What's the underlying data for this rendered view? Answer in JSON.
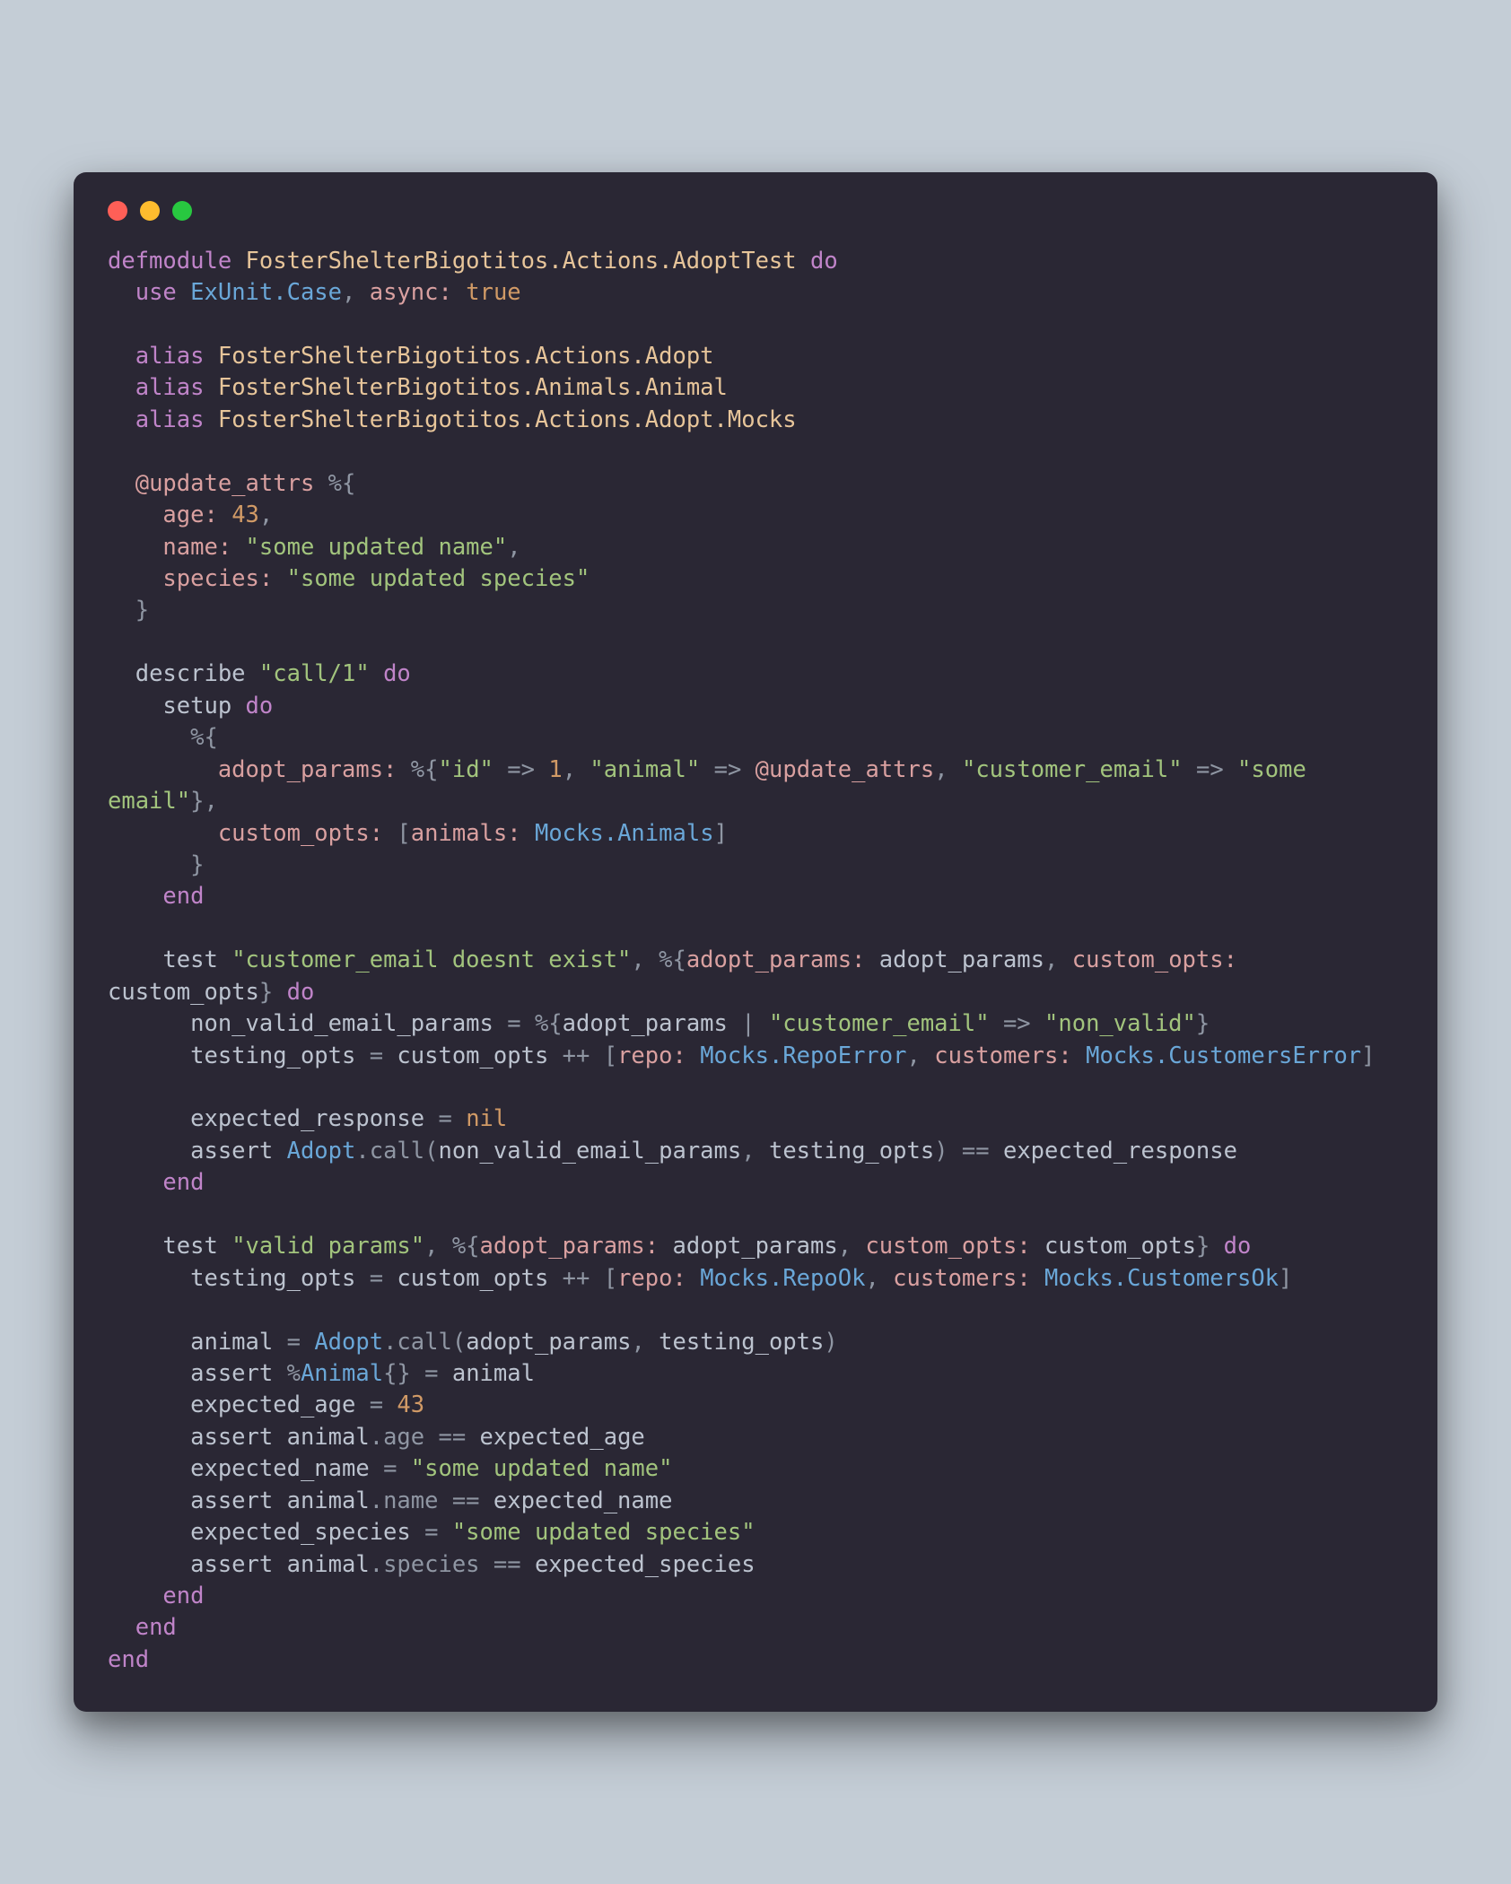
{
  "code": {
    "tokens": [
      [
        [
          "kw",
          "defmodule"
        ],
        [
          "punc",
          " "
        ],
        [
          "mod",
          "FosterShelterBigotitos.Actions.AdoptTest"
        ],
        [
          "punc",
          " "
        ],
        [
          "kw",
          "do"
        ]
      ],
      [
        [
          "punc",
          "  "
        ],
        [
          "kw",
          "use"
        ],
        [
          "punc",
          " "
        ],
        [
          "cls",
          "ExUnit.Case"
        ],
        [
          "punc",
          ", "
        ],
        [
          "atom",
          "async:"
        ],
        [
          "punc",
          " "
        ],
        [
          "bool",
          "true"
        ]
      ],
      [],
      [
        [
          "punc",
          "  "
        ],
        [
          "kw",
          "alias"
        ],
        [
          "punc",
          " "
        ],
        [
          "mod",
          "FosterShelterBigotitos.Actions.Adopt"
        ]
      ],
      [
        [
          "punc",
          "  "
        ],
        [
          "kw",
          "alias"
        ],
        [
          "punc",
          " "
        ],
        [
          "mod",
          "FosterShelterBigotitos.Animals.Animal"
        ]
      ],
      [
        [
          "punc",
          "  "
        ],
        [
          "kw",
          "alias"
        ],
        [
          "punc",
          " "
        ],
        [
          "mod",
          "FosterShelterBigotitos.Actions.Adopt.Mocks"
        ]
      ],
      [],
      [
        [
          "punc",
          "  "
        ],
        [
          "atom",
          "@update_attrs"
        ],
        [
          "punc",
          " %{"
        ]
      ],
      [
        [
          "punc",
          "    "
        ],
        [
          "atom",
          "age:"
        ],
        [
          "punc",
          " "
        ],
        [
          "num",
          "43"
        ],
        [
          "punc",
          ","
        ]
      ],
      [
        [
          "punc",
          "    "
        ],
        [
          "atom",
          "name:"
        ],
        [
          "punc",
          " "
        ],
        [
          "str",
          "\"some updated name\""
        ],
        [
          "punc",
          ","
        ]
      ],
      [
        [
          "punc",
          "    "
        ],
        [
          "atom",
          "species:"
        ],
        [
          "punc",
          " "
        ],
        [
          "str",
          "\"some updated species\""
        ]
      ],
      [
        [
          "punc",
          "  }"
        ]
      ],
      [],
      [
        [
          "punc",
          "  "
        ],
        [
          "id",
          "describe "
        ],
        [
          "str",
          "\"call/1\""
        ],
        [
          "punc",
          " "
        ],
        [
          "kw",
          "do"
        ]
      ],
      [
        [
          "punc",
          "    "
        ],
        [
          "id",
          "setup "
        ],
        [
          "kw",
          "do"
        ]
      ],
      [
        [
          "punc",
          "      %{"
        ]
      ],
      [
        [
          "punc",
          "        "
        ],
        [
          "atom",
          "adopt_params:"
        ],
        [
          "punc",
          " %{"
        ],
        [
          "str",
          "\"id\""
        ],
        [
          "punc",
          " => "
        ],
        [
          "num",
          "1"
        ],
        [
          "punc",
          ", "
        ],
        [
          "str",
          "\"animal\""
        ],
        [
          "punc",
          " => "
        ],
        [
          "atom",
          "@update_attrs"
        ],
        [
          "punc",
          ", "
        ],
        [
          "str",
          "\"customer_email\""
        ],
        [
          "punc",
          " => "
        ],
        [
          "str",
          "\"some email\""
        ],
        [
          "punc",
          "},"
        ]
      ],
      [
        [
          "punc",
          "        "
        ],
        [
          "atom",
          "custom_opts:"
        ],
        [
          "punc",
          " ["
        ],
        [
          "atom",
          "animals:"
        ],
        [
          "punc",
          " "
        ],
        [
          "cls",
          "Mocks.Animals"
        ],
        [
          "punc",
          "]"
        ]
      ],
      [
        [
          "punc",
          "      }"
        ]
      ],
      [
        [
          "punc",
          "    "
        ],
        [
          "kw",
          "end"
        ]
      ],
      [],
      [
        [
          "punc",
          "    "
        ],
        [
          "id",
          "test "
        ],
        [
          "str",
          "\"customer_email doesnt exist\""
        ],
        [
          "punc",
          ", %{"
        ],
        [
          "atom",
          "adopt_params:"
        ],
        [
          "punc",
          " "
        ],
        [
          "id",
          "adopt_params"
        ],
        [
          "punc",
          ", "
        ],
        [
          "atom",
          "custom_opts:"
        ],
        [
          "punc",
          " "
        ],
        [
          "id",
          "custom_opts"
        ],
        [
          "punc",
          "} "
        ],
        [
          "kw",
          "do"
        ]
      ],
      [
        [
          "punc",
          "      "
        ],
        [
          "id",
          "non_valid_email_params"
        ],
        [
          "punc",
          " = %{"
        ],
        [
          "id",
          "adopt_params"
        ],
        [
          "punc",
          " | "
        ],
        [
          "str",
          "\"customer_email\""
        ],
        [
          "punc",
          " => "
        ],
        [
          "str",
          "\"non_valid\""
        ],
        [
          "punc",
          "}"
        ]
      ],
      [
        [
          "punc",
          "      "
        ],
        [
          "id",
          "testing_opts"
        ],
        [
          "punc",
          " = "
        ],
        [
          "id",
          "custom_opts"
        ],
        [
          "punc",
          " ++ ["
        ],
        [
          "atom",
          "repo:"
        ],
        [
          "punc",
          " "
        ],
        [
          "cls",
          "Mocks.RepoError"
        ],
        [
          "punc",
          ", "
        ],
        [
          "atom",
          "customers:"
        ],
        [
          "punc",
          " "
        ],
        [
          "cls",
          "Mocks.CustomersError"
        ],
        [
          "punc",
          "]"
        ]
      ],
      [],
      [
        [
          "punc",
          "      "
        ],
        [
          "id",
          "expected_response"
        ],
        [
          "punc",
          " = "
        ],
        [
          "bool",
          "nil"
        ]
      ],
      [
        [
          "punc",
          "      "
        ],
        [
          "id",
          "assert "
        ],
        [
          "cls",
          "Adopt"
        ],
        [
          "punc",
          ".call("
        ],
        [
          "id",
          "non_valid_email_params"
        ],
        [
          "punc",
          ", "
        ],
        [
          "id",
          "testing_opts"
        ],
        [
          "punc",
          ") == "
        ],
        [
          "id",
          "expected_response"
        ]
      ],
      [
        [
          "punc",
          "    "
        ],
        [
          "kw",
          "end"
        ]
      ],
      [],
      [
        [
          "punc",
          "    "
        ],
        [
          "id",
          "test "
        ],
        [
          "str",
          "\"valid params\""
        ],
        [
          "punc",
          ", %{"
        ],
        [
          "atom",
          "adopt_params:"
        ],
        [
          "punc",
          " "
        ],
        [
          "id",
          "adopt_params"
        ],
        [
          "punc",
          ", "
        ],
        [
          "atom",
          "custom_opts:"
        ],
        [
          "punc",
          " "
        ],
        [
          "id",
          "custom_opts"
        ],
        [
          "punc",
          "} "
        ],
        [
          "kw",
          "do"
        ]
      ],
      [
        [
          "punc",
          "      "
        ],
        [
          "id",
          "testing_opts"
        ],
        [
          "punc",
          " = "
        ],
        [
          "id",
          "custom_opts"
        ],
        [
          "punc",
          " ++ ["
        ],
        [
          "atom",
          "repo:"
        ],
        [
          "punc",
          " "
        ],
        [
          "cls",
          "Mocks.RepoOk"
        ],
        [
          "punc",
          ", "
        ],
        [
          "atom",
          "customers:"
        ],
        [
          "punc",
          " "
        ],
        [
          "cls",
          "Mocks.CustomersOk"
        ],
        [
          "punc",
          "]"
        ]
      ],
      [],
      [
        [
          "punc",
          "      "
        ],
        [
          "id",
          "animal"
        ],
        [
          "punc",
          " = "
        ],
        [
          "cls",
          "Adopt"
        ],
        [
          "punc",
          ".call("
        ],
        [
          "id",
          "adopt_params"
        ],
        [
          "punc",
          ", "
        ],
        [
          "id",
          "testing_opts"
        ],
        [
          "punc",
          ")"
        ]
      ],
      [
        [
          "punc",
          "      "
        ],
        [
          "id",
          "assert "
        ],
        [
          "punc",
          "%"
        ],
        [
          "cls",
          "Animal"
        ],
        [
          "punc",
          "{} = "
        ],
        [
          "id",
          "animal"
        ]
      ],
      [
        [
          "punc",
          "      "
        ],
        [
          "id",
          "expected_age"
        ],
        [
          "punc",
          " = "
        ],
        [
          "num",
          "43"
        ]
      ],
      [
        [
          "punc",
          "      "
        ],
        [
          "id",
          "assert "
        ],
        [
          "id",
          "animal"
        ],
        [
          "punc",
          ".age == "
        ],
        [
          "id",
          "expected_age"
        ]
      ],
      [
        [
          "punc",
          "      "
        ],
        [
          "id",
          "expected_name"
        ],
        [
          "punc",
          " = "
        ],
        [
          "str",
          "\"some updated name\""
        ]
      ],
      [
        [
          "punc",
          "      "
        ],
        [
          "id",
          "assert "
        ],
        [
          "id",
          "animal"
        ],
        [
          "punc",
          ".name == "
        ],
        [
          "id",
          "expected_name"
        ]
      ],
      [
        [
          "punc",
          "      "
        ],
        [
          "id",
          "expected_species"
        ],
        [
          "punc",
          " = "
        ],
        [
          "str",
          "\"some updated species\""
        ]
      ],
      [
        [
          "punc",
          "      "
        ],
        [
          "id",
          "assert "
        ],
        [
          "id",
          "animal"
        ],
        [
          "punc",
          ".species == "
        ],
        [
          "id",
          "expected_species"
        ]
      ],
      [
        [
          "punc",
          "    "
        ],
        [
          "kw",
          "end"
        ]
      ],
      [
        [
          "punc",
          "  "
        ],
        [
          "kw",
          "end"
        ]
      ],
      [
        [
          "kw",
          "end"
        ]
      ]
    ]
  }
}
